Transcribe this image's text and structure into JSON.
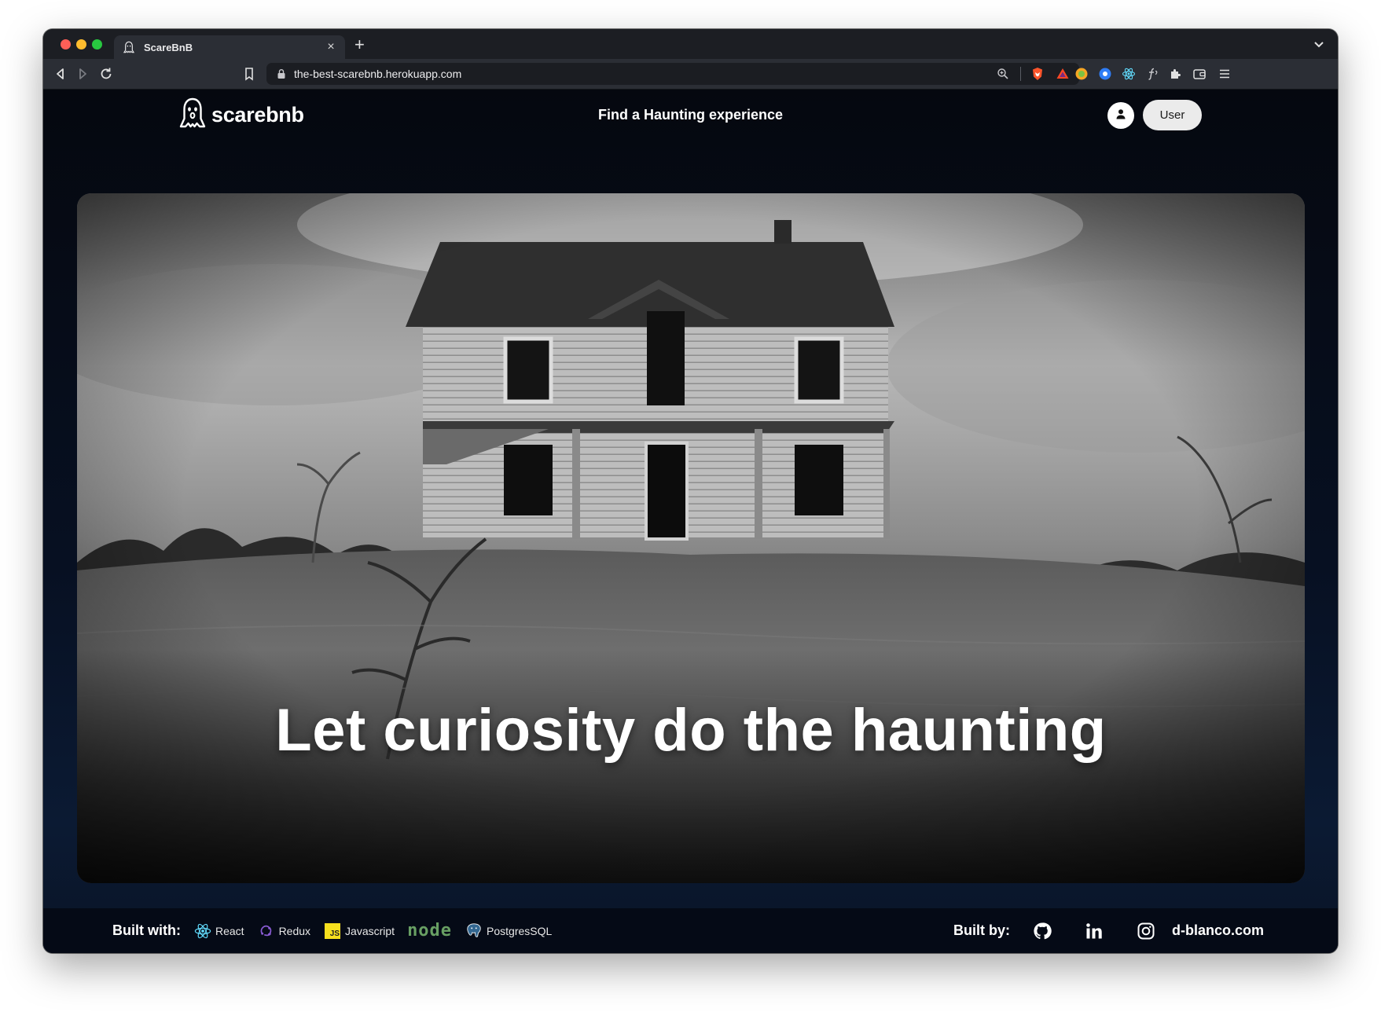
{
  "browser": {
    "tab_title": "ScareBnB",
    "tab_close": "×",
    "new_tab": "+",
    "url": "the-best-scarebnb.herokuapp.com"
  },
  "header": {
    "logo_text": "scarebnb",
    "center_link": "Find a Haunting experience",
    "user_button": "User"
  },
  "hero": {
    "title": "Let curiosity do the haunting"
  },
  "footer": {
    "built_with_label": "Built with:",
    "tech": [
      "React",
      "Redux",
      "Javascript",
      "PostgresSQL"
    ],
    "node_logo": "node",
    "js_badge": "JS",
    "built_by_label": "Built by:",
    "site_link": "d-blanco.com"
  },
  "colors": {
    "page_bg": "#060c18",
    "user_button_bg": "#ebebeb",
    "react": "#61dafb",
    "redux": "#764abc",
    "javascript": "#f7df1e",
    "node": "#689f63",
    "postgres": "#336791"
  }
}
